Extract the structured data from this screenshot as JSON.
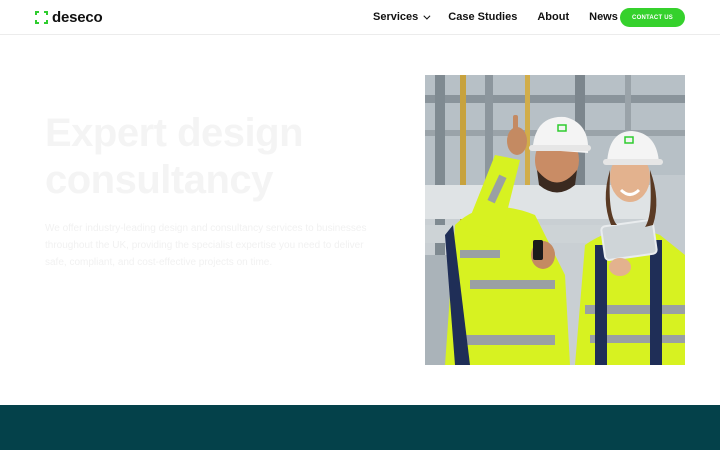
{
  "header": {
    "logo_text": "deseco",
    "nav": {
      "services": "Services",
      "case_studies": "Case Studies",
      "about": "About",
      "news": "News"
    },
    "contact_label": "CONTACT US"
  },
  "hero": {
    "title": "Expert design consultancy",
    "body": "We offer industry-leading design and consultancy services to businesses throughout the UK, providing the specialist expertise you need to deliver safe, compliant, and cost-effective projects on time."
  },
  "colors": {
    "accent_green": "#35d12c",
    "band_teal": "#04414a"
  },
  "icons": [
    "logo-mark-icon",
    "chevron-down-icon"
  ]
}
